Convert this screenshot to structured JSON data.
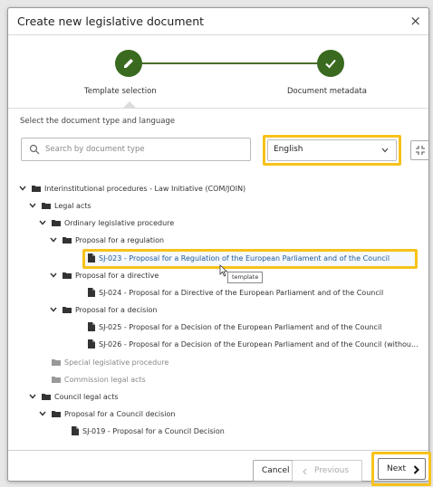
{
  "dialog": {
    "title": "Create new legislative document",
    "close_glyph": "×"
  },
  "steps": [
    {
      "label": "Template selection",
      "icon": "pencil-icon",
      "state": "active"
    },
    {
      "label": "Document metadata",
      "icon": "check-icon",
      "state": "complete"
    }
  ],
  "colors": {
    "step_green": "#3a6a1f",
    "highlight_yellow": "#f7c21a",
    "link_blue": "#1f5c99"
  },
  "filter": {
    "section_label": "Select the document type and language",
    "search_placeholder": "Search by document type",
    "language": "English"
  },
  "tree": [
    {
      "label": "Interinstitutional procedures - Law Initiative (COM/JOIN)",
      "kind": "folder",
      "expanded": true,
      "level": 0
    },
    {
      "label": "Legal acts",
      "kind": "folder",
      "expanded": true,
      "level": 1
    },
    {
      "label": "Ordinary legislative procedure",
      "kind": "folder",
      "expanded": true,
      "level": 2
    },
    {
      "label": "Proposal for a regulation",
      "kind": "folder",
      "expanded": true,
      "level": 3
    },
    {
      "label": "SJ-023 - Proposal for a Regulation of the European Parliament and of the Council",
      "kind": "template",
      "selected": true,
      "level": 4
    },
    {
      "label": "Proposal for a directive",
      "kind": "folder",
      "expanded": true,
      "level": 3
    },
    {
      "label": "SJ-024 - Proposal for a Directive of the European Parliament and of the Council",
      "kind": "template",
      "level": 4
    },
    {
      "label": "Proposal for a decision",
      "kind": "folder",
      "expanded": true,
      "level": 3
    },
    {
      "label": "SJ-025 - Proposal for a Decision of the European Parliament and of the Council",
      "kind": "template",
      "level": 4
    },
    {
      "label": "SJ-026 - Proposal for a Decision of the European Parliament and of the Council (withou...",
      "kind": "template",
      "level": 4
    },
    {
      "label": "Special legislative procedure",
      "kind": "folder",
      "muted": true,
      "level": 2
    },
    {
      "label": "Commission legal acts",
      "kind": "folder",
      "muted": true,
      "level": 2
    },
    {
      "label": "Council legal acts",
      "kind": "folder",
      "expanded": true,
      "level": 1
    },
    {
      "label": "Proposal for a Council decision",
      "kind": "folder",
      "expanded": true,
      "level": 2
    },
    {
      "label": "SJ-019 - Proposal for a Council Decision",
      "kind": "template",
      "level": 3
    }
  ],
  "tooltip": "template",
  "footer": {
    "cancel": "Cancel",
    "previous": "Previous",
    "next": "Next"
  }
}
